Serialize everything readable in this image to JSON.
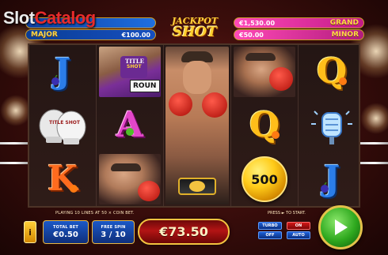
{
  "watermark": {
    "part1": "Slot",
    "part2": "Catalog"
  },
  "jackpots": {
    "logo_top": "JACKPOT",
    "logo_bottom": "SHOT",
    "mega": {
      "name": "",
      "value": ""
    },
    "major": {
      "name": "MAJOR",
      "value": "€100.00"
    },
    "grand": {
      "name": "GRAND",
      "value": "€1,530.00"
    },
    "minor": {
      "name": "MINOR",
      "value": "€50.00"
    }
  },
  "reels": [
    [
      "J",
      "boxing-gloves",
      "K"
    ],
    [
      "ring-girl",
      "A",
      "boxer-portrait"
    ],
    [
      "boxer-tall",
      "boxer-tall",
      "boxer-tall"
    ],
    [
      "boxer-portrait",
      "Q",
      "500"
    ],
    [
      "Q",
      "microphone",
      "J"
    ]
  ],
  "symbols": {
    "ring_girl_text1": "TITLE",
    "ring_girl_text2": "SHOT",
    "ring_girl_text3": "ROUN",
    "coin_value": "500",
    "gloves_text": "TITLE SHOT"
  },
  "status": {
    "lines_text": "PLAYING 10 LINES AT 50 × COIN BET.",
    "press_text": "PRESS ► TO START."
  },
  "controls": {
    "info_label": "i",
    "total_bet_label": "TOTAL BET",
    "total_bet_value": "€0.50",
    "free_spin_label": "FREE SPIN",
    "free_spin_value": "3 / 10",
    "win_value": "€73.50",
    "turbo_label": "TURBO",
    "turbo_state": "OFF",
    "on_label": "ON",
    "auto_label": "AUTO"
  },
  "colors": {
    "accent_gold": "#f2c340",
    "jackpot_blue": "#1f6fe0",
    "jackpot_pink": "#ff49b8",
    "spin_green": "#2ea81e",
    "win_red": "#b31414"
  }
}
